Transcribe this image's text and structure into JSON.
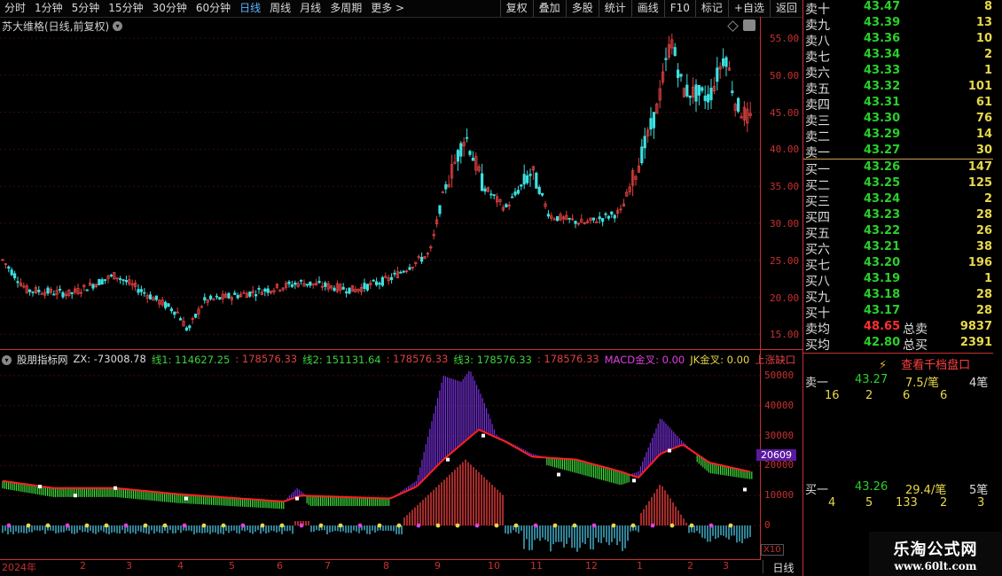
{
  "topbar": {
    "left_items": [
      "分时",
      "1分钟",
      "5分钟",
      "15分钟",
      "30分钟",
      "60分钟",
      "日线",
      "周线",
      "月线",
      "多周期",
      "更多 >"
    ],
    "active": "日线",
    "right_items": [
      "复权",
      "叠加",
      "多股",
      "统计",
      "画线",
      "F10",
      "标记",
      "+自选",
      "返回"
    ]
  },
  "main_chart": {
    "title": "苏大维格(日线,前复权)",
    "price_axis": [
      "55.00",
      "50.00",
      "45.00",
      "40.00",
      "35.00",
      "30.00",
      "25.00",
      "20.00",
      "15.00"
    ]
  },
  "indicator": {
    "name": "股朋指标网",
    "items": [
      {
        "text": "ZX: -73008.78",
        "color": "#dddddd"
      },
      {
        "text": "线1: 114627.25",
        "color": "#3cd23c"
      },
      {
        "text": ": 178576.33",
        "color": "#e04040"
      },
      {
        "text": "线2: 151131.64",
        "color": "#3cd23c"
      },
      {
        "text": ": 178576.33",
        "color": "#e04040"
      },
      {
        "text": "线3: 178576.33",
        "color": "#3cd23c"
      },
      {
        "text": ": 178576.33",
        "color": "#e04040"
      },
      {
        "text": "MACD金叉: 0.00",
        "color": "#e040e0"
      },
      {
        "text": "JK金叉: 0.00",
        "color": "#e8d84a"
      },
      {
        "text": "上涨缺口",
        "color": "#e04040"
      }
    ],
    "axis": [
      "50000",
      "40000",
      "30000",
      "20000",
      "10000",
      "0"
    ],
    "current_tag": "20609",
    "scale_badge": "X10"
  },
  "date_axis": [
    "2024年",
    "2",
    "3",
    "4",
    "5",
    "6",
    "7",
    "8",
    "9",
    "10",
    "11",
    "12",
    "1",
    "2",
    "3"
  ],
  "period_label": "日线",
  "orderbook": {
    "sells": [
      {
        "label": "卖十",
        "price": "43.47",
        "vol": "8"
      },
      {
        "label": "卖九",
        "price": "43.39",
        "vol": "13"
      },
      {
        "label": "卖八",
        "price": "43.36",
        "vol": "10"
      },
      {
        "label": "卖七",
        "price": "43.34",
        "vol": "2"
      },
      {
        "label": "卖六",
        "price": "43.33",
        "vol": "1"
      },
      {
        "label": "卖五",
        "price": "43.32",
        "vol": "101"
      },
      {
        "label": "卖四",
        "price": "43.31",
        "vol": "61"
      },
      {
        "label": "卖三",
        "price": "43.30",
        "vol": "76"
      },
      {
        "label": "卖二",
        "price": "43.29",
        "vol": "14"
      },
      {
        "label": "卖一",
        "price": "43.27",
        "vol": "30"
      }
    ],
    "buys": [
      {
        "label": "买一",
        "price": "43.26",
        "vol": "147"
      },
      {
        "label": "买二",
        "price": "43.25",
        "vol": "125"
      },
      {
        "label": "买三",
        "price": "43.24",
        "vol": "2"
      },
      {
        "label": "买四",
        "price": "43.23",
        "vol": "28"
      },
      {
        "label": "买五",
        "price": "43.22",
        "vol": "26"
      },
      {
        "label": "买六",
        "price": "43.21",
        "vol": "38"
      },
      {
        "label": "买七",
        "price": "43.20",
        "vol": "196"
      },
      {
        "label": "买八",
        "price": "43.19",
        "vol": "1"
      },
      {
        "label": "买九",
        "price": "43.18",
        "vol": "28"
      },
      {
        "label": "买十",
        "price": "43.17",
        "vol": "28"
      }
    ],
    "avg_sell": {
      "label": "卖均",
      "price": "48.65",
      "tot_label": "总卖",
      "tot": "9837"
    },
    "avg_buy": {
      "label": "买均",
      "price": "42.80",
      "tot_label": "总买",
      "tot": "2391"
    },
    "view_1000": "查看千档盘口",
    "sell1_queue": {
      "label": "卖一",
      "price": "43.27",
      "per": "7.5/笔",
      "count": "4笔",
      "orders": [
        "16",
        "2",
        "6",
        "6"
      ]
    },
    "buy1_queue": {
      "label": "买一",
      "price": "43.26",
      "per": "29.4/笔",
      "count": "5笔",
      "orders": [
        "4",
        "5",
        "133",
        "2",
        "3"
      ]
    }
  },
  "watermark": {
    "title": "乐淘公式网",
    "url": "www.60lt.com"
  },
  "colors": {
    "up": "#e04040",
    "down": "#3ce0e0",
    "axis": "#c83030",
    "buy_price": "#2ad02a",
    "volume": "#e8d84a"
  }
}
